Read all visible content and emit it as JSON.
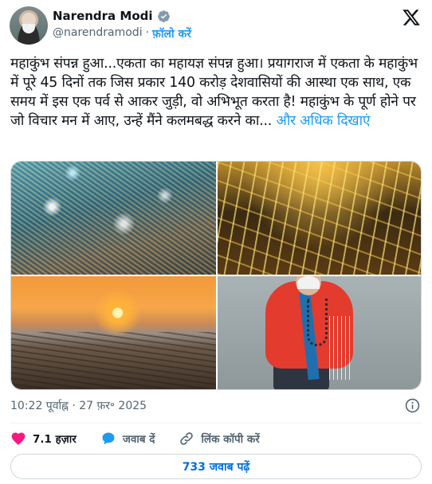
{
  "header": {
    "name": "Narendra Modi",
    "handle": "@narendramodi",
    "separator": "·",
    "follow_label": "फ़ॉलो करें"
  },
  "tweet": {
    "text": "महाकुंभ संपन्न हुआ...एकता का महायज्ञ संपन्न हुआ। प्रयागराज में एकता के महाकुंभ में पूरे 45 दिनों तक जिस प्रकार 140 करोड़ देशवासियों की आस्था एक साथ, एक समय में इस एक पर्व से आकर जुड़ी, वो अभिभूत करता है! महाकुंभ के पूर्ण होने पर जो विचार मन में आए, उन्हें मैंने कलमबद्ध करने का...",
    "show_more": "और अधिक दिखाएं",
    "timestamp": "10:22 पूर्वाह्न · 27 फ़र॰ 2025"
  },
  "actions": {
    "like_count": "7.1 हज़ार",
    "reply_label": "जवाब दें",
    "copy_link_label": "लिंक कॉपी करें"
  },
  "replies_button": "733 जवाब पढ़ें",
  "colors": {
    "accent": "#1d9bf0",
    "like": "#f91880",
    "reply_btn_text": "#006fd6",
    "secondary_text": "#536471"
  },
  "icons": [
    "verified-badge-icon",
    "x-logo-icon",
    "info-icon",
    "heart-icon",
    "reply-icon",
    "link-icon"
  ]
}
